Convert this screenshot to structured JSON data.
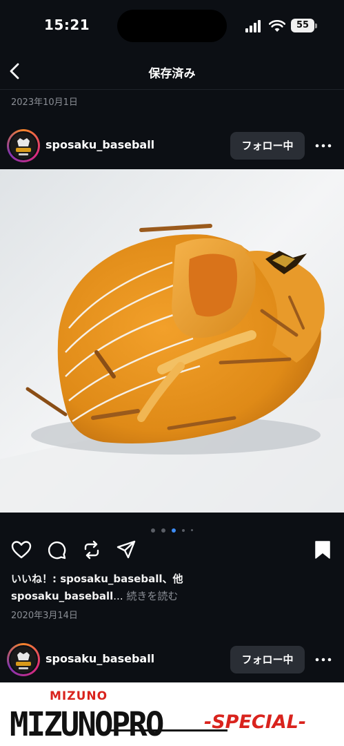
{
  "status_bar": {
    "time": "15:21",
    "battery_level": "55",
    "icons": [
      "cellular-signal-icon",
      "wifi-icon",
      "battery-icon"
    ]
  },
  "nav": {
    "title": "保存済み",
    "back_icon": "chevron-left-icon"
  },
  "section_date": "2023年10月1日",
  "posts": [
    {
      "username": "sposaku_baseball",
      "follow_label": "フォロー中",
      "more_icon": "more-horizontal-icon",
      "image_subject": "orange leather baseball glove",
      "carousel": {
        "count": 5,
        "active_index": 2
      },
      "actions": [
        "heart-icon",
        "comment-icon",
        "repost-icon",
        "share-icon",
        "bookmark-icon"
      ],
      "likes_text": "いいね！: sposaku_baseball、他",
      "caption_user": "sposaku_baseball",
      "caption_ellipsis": "...",
      "read_more": "続きを読む",
      "date": "2020年3月14日"
    },
    {
      "username": "sposaku_baseball",
      "follow_label": "フォロー中",
      "more_icon": "more-horizontal-icon",
      "image_text": {
        "brand_small": "MIZUNO",
        "brand_big": "MIZUNOPRO",
        "special": "-SPECIAL-"
      }
    }
  ],
  "colors": {
    "background": "#0c0f14",
    "follow_button": "#2a2e35",
    "carousel_active": "#3d8cf5",
    "glove": "#e8961e",
    "brand_red": "#d9231d"
  }
}
